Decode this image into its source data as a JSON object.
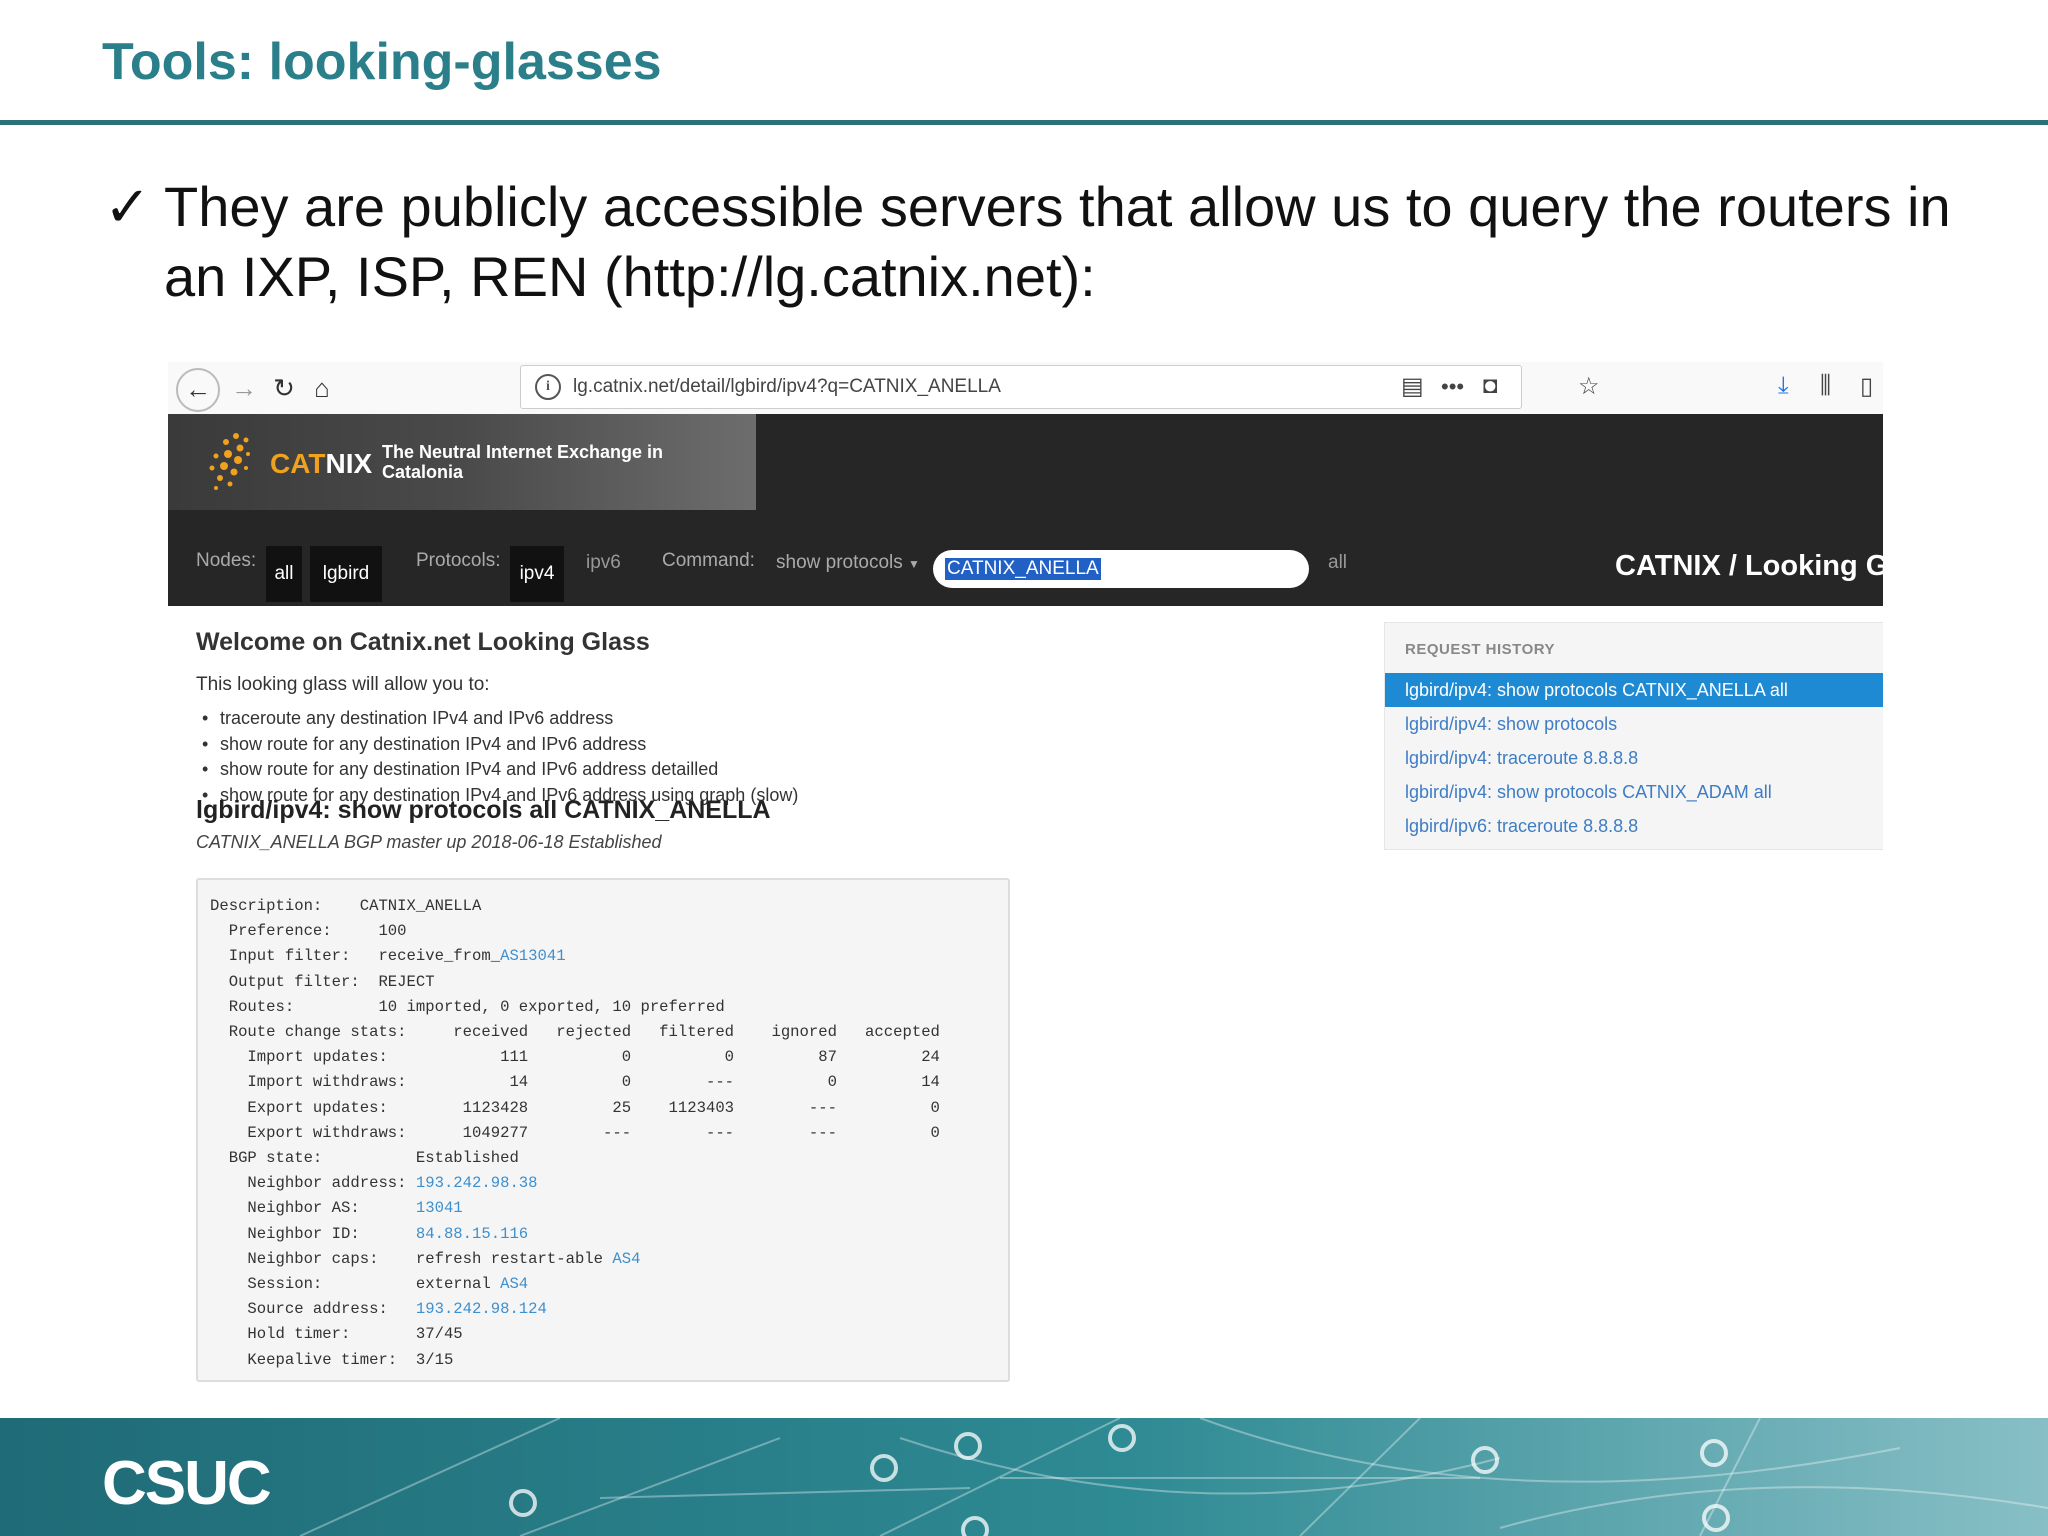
{
  "slide": {
    "title": "Tools: looking-glasses",
    "bullet_mark": "✓",
    "bullet_text": "They are publicly accessible servers that allow us to query the routers in an IXP, ISP, REN (http://lg.catnix.net):",
    "footer_logo": "CSUC"
  },
  "browser": {
    "url": "lg.catnix.net/detail/lgbird/ipv4?q=CATNIX_ANELLA",
    "icons": [
      "back-icon",
      "forward-icon",
      "reload-icon",
      "home-icon",
      "info-icon",
      "reader-icon",
      "more-icon",
      "pocket-icon",
      "star-icon",
      "download-icon",
      "library-icon",
      "sidebar-icon"
    ]
  },
  "lg": {
    "logo": {
      "cat": "CAT",
      "nix": "NIX",
      "tagline": "The Neutral Internet Exchange in Catalonia"
    },
    "nav": {
      "nodes_label": "Nodes:",
      "node_all": "all",
      "node_lgbird": "lgbird",
      "protocols_label": "Protocols:",
      "proto_ipv4": "ipv4",
      "proto_ipv6": "ipv6",
      "command_label": "Command:",
      "command_value": "show protocols",
      "query": "CATNIX_ANELLA",
      "all_suffix": "all",
      "brand": "CATNIX / Looking Gl"
    },
    "welcome_title": "Welcome on Catnix.net Looking Glass",
    "intro": "This looking glass will allow you to:",
    "features": [
      "traceroute any destination IPv4 and IPv6 address",
      "show route for any destination IPv4 and IPv6 address",
      "show route for any destination IPv4 and IPv6 address detailled",
      "show route for any destination IPv4 and IPv6 address using graph (slow)"
    ],
    "query_title": "lgbird/ipv4: show protocols all CATNIX_ANELLA",
    "query_subtitle": "CATNIX_ANELLA BGP master up 2018-06-18 Established",
    "result_lines": {
      "description": "Description:    CATNIX_ANELLA",
      "preference": "  Preference:     100",
      "input_filter_prefix": "  Input filter:   receive_from_",
      "input_filter_as": "AS13041",
      "output_filter": "  Output filter:  REJECT",
      "routes": "  Routes:         10 imported, 0 exported, 10 preferred",
      "stats_header": "  Route change stats:     received   rejected   filtered    ignored   accepted",
      "import_updates": "    Import updates:            111          0          0         87         24",
      "import_withdraws": "    Import withdraws:           14          0        ---          0         14",
      "export_updates": "    Export updates:        1123428         25    1123403        ---          0",
      "export_withdraws": "    Export withdraws:      1049277        ---        ---        ---          0",
      "bgp_state": "  BGP state:          Established",
      "neighbor_address_label": "    Neighbor address: ",
      "neighbor_address": "193.242.98.38",
      "neighbor_as_label": "    Neighbor AS:      ",
      "neighbor_as": "13041",
      "neighbor_id_label": "    Neighbor ID:      ",
      "neighbor_id": "84.88.15.116",
      "neighbor_caps_label": "    Neighbor caps:    refresh restart-able ",
      "neighbor_caps_as": "AS4",
      "session_label": "    Session:          external ",
      "session_as": "AS4",
      "source_address_label": "    Source address:   ",
      "source_address": "193.242.98.124",
      "hold_timer": "    Hold timer:       37/45",
      "keepalive_timer": "    Keepalive timer:  3/15"
    },
    "history": {
      "title": "REQUEST HISTORY",
      "items": [
        "lgbird/ipv4: show protocols CATNIX_ANELLA all",
        "lgbird/ipv4: show protocols",
        "lgbird/ipv4: traceroute 8.8.8.8",
        "lgbird/ipv4: show protocols CATNIX_ADAM all",
        "lgbird/ipv6: traceroute 8.8.8.8"
      ],
      "active_index": 0
    },
    "colors": {
      "accent": "#1f8ad4",
      "link": "#3e7dc4",
      "brand_orange": "#f0a21d",
      "header_bg": "#262626",
      "slide_teal": "#2a7f8a"
    }
  }
}
